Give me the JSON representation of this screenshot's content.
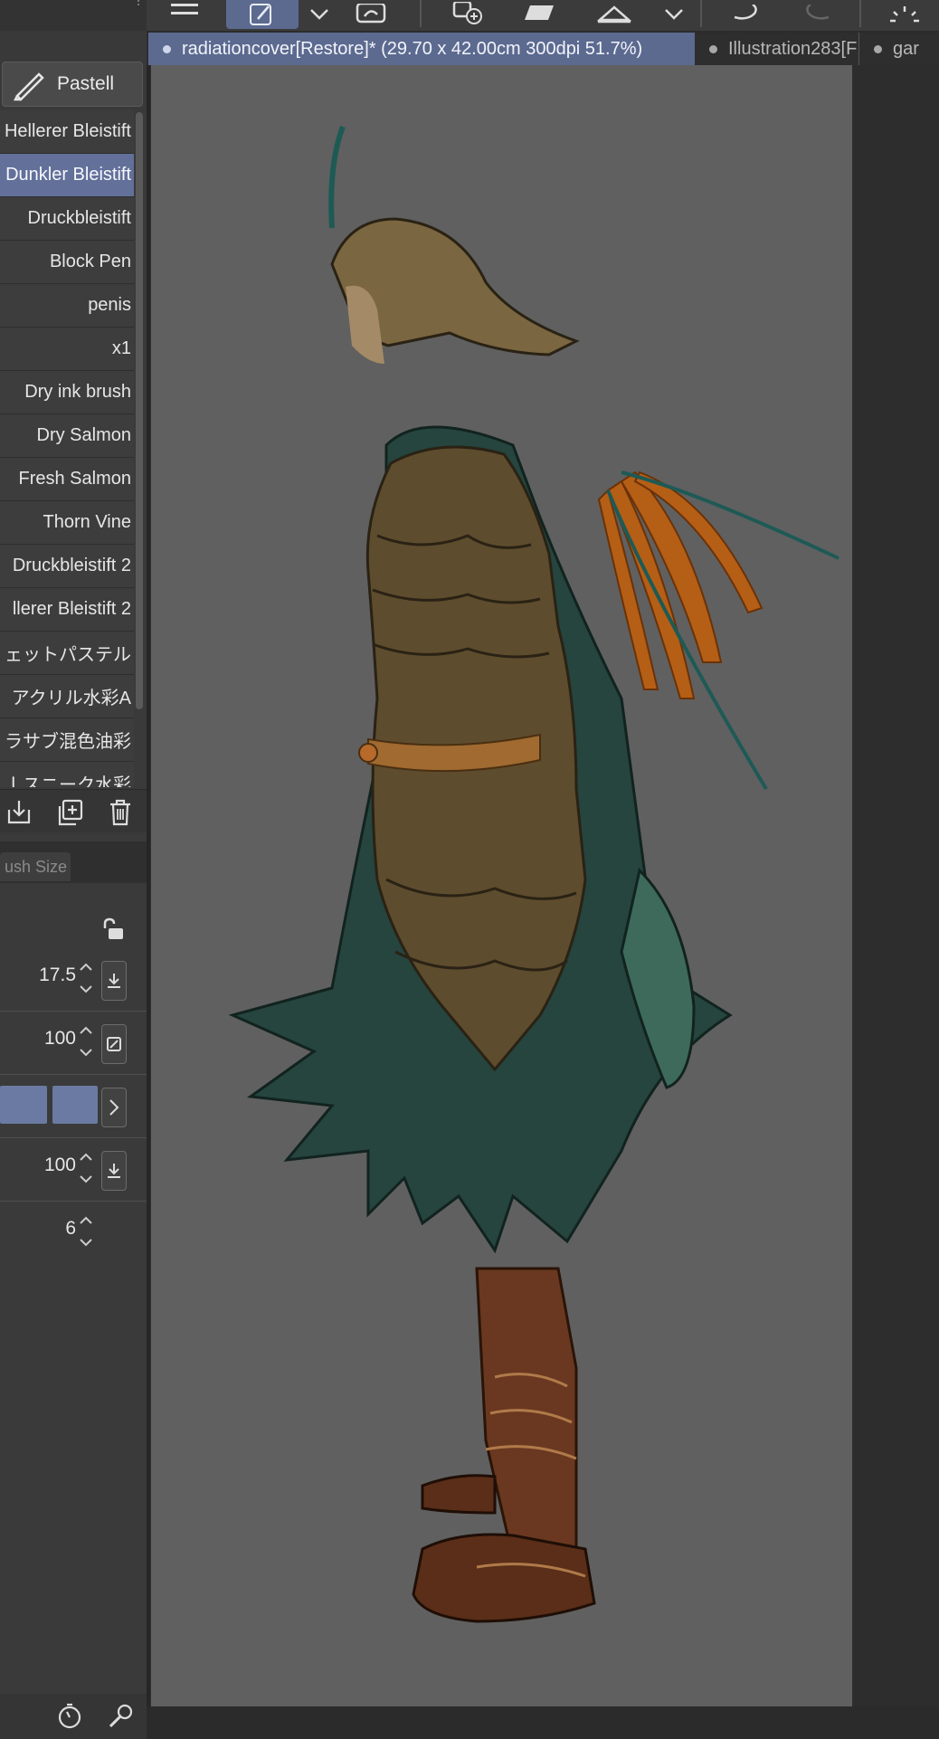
{
  "toolbar": {
    "icons": [
      "menu-icon",
      "pen-edit-icon",
      "chevron-down-icon",
      "lasso-icon",
      "add-canvas-icon",
      "fill-icon",
      "triangle-ruler-icon",
      "chevron-down-icon",
      "undo-icon",
      "redo-icon",
      "loading-icon"
    ],
    "active_color": "#5c6a90"
  },
  "tabs": [
    {
      "label": "radiationcover[Restore]* (29.70 x 42.00cm 300dpi 51.7%)",
      "active": true
    },
    {
      "label": "Illustration283[F",
      "active": false
    },
    {
      "label": "gar",
      "active": false
    }
  ],
  "brush_panel": {
    "current_tool": "Pastell",
    "items": [
      "Hellerer Bleistift",
      "Dunkler Bleistift",
      "Druckbleistift",
      "Block Pen",
      "penis",
      "x1",
      "Dry ink brush",
      "Dry Salmon",
      "Fresh Salmon",
      "Thorn Vine",
      "Druckbleistift 2",
      "llerer Bleistift 2",
      "ェットパステル",
      "アクリル水彩A",
      "ラサブ混色油彩",
      "ｌスニーク水彩"
    ],
    "selected_index": 1,
    "actions": [
      "import-icon",
      "duplicate-icon",
      "trash-icon"
    ]
  },
  "property_panel": {
    "tab_label": "ush Size",
    "brush_size": "17.5",
    "opacity": "100",
    "density": "100",
    "stabilization": "6",
    "swatch_color": "#6a7aa2"
  },
  "bottom_icons": [
    "stopwatch-icon",
    "wrench-icon"
  ],
  "canvas": {
    "background": "#606060"
  }
}
